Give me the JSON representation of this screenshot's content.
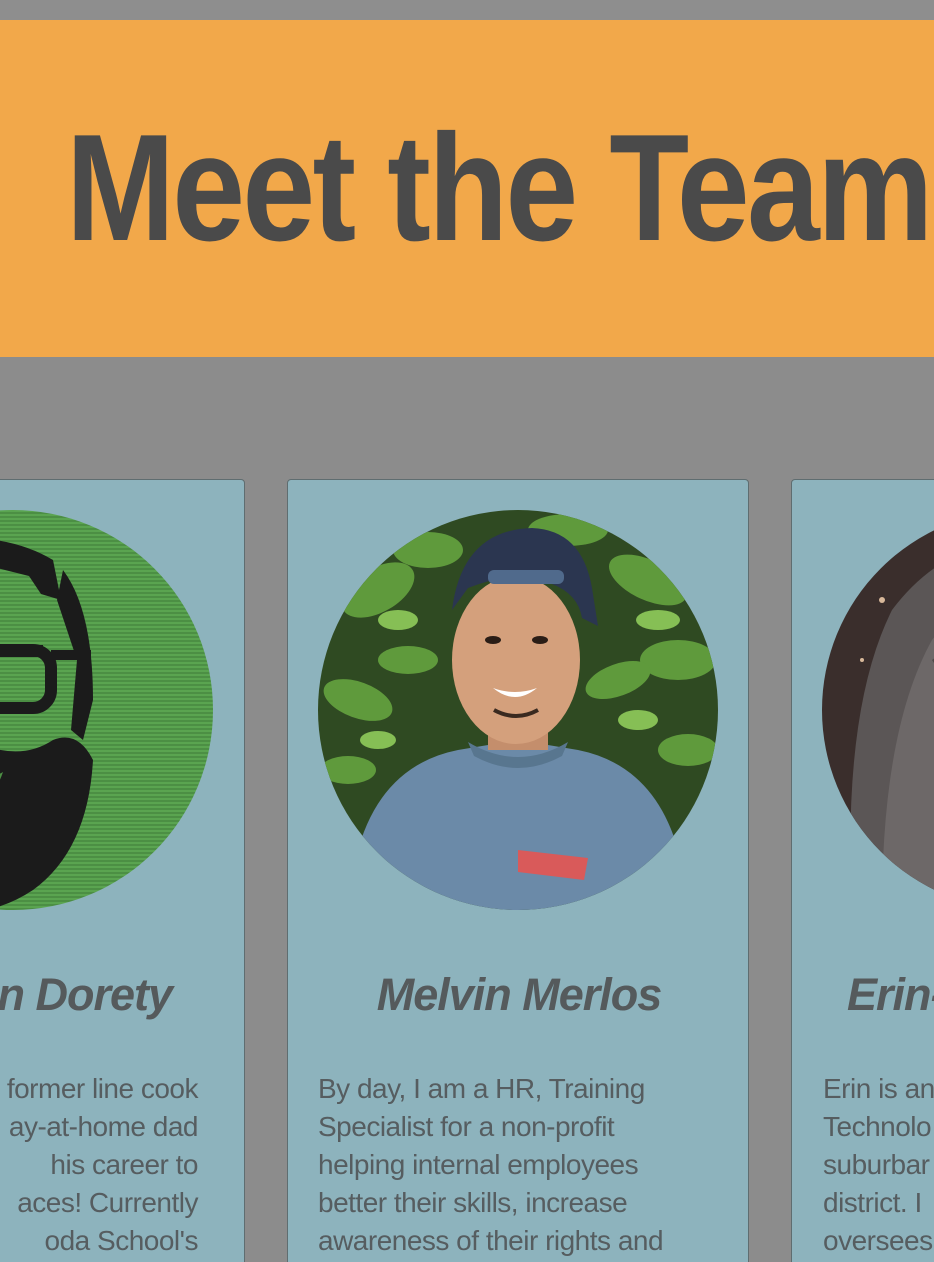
{
  "header": {
    "title": "Meet the Team"
  },
  "members": [
    {
      "name": "an Dorety",
      "photo": "pixelated-green-portrait-image",
      "bio_lines": [
        "former line cook",
        "ay-at-home dad",
        "his career to",
        "aces! Currently",
        "oda School's"
      ]
    },
    {
      "name": "Melvin Merlos",
      "photo": "portrait-photo-outdoors",
      "bio_lines": [
        "By day, I am a HR, Training",
        "Specialist for a non-profit",
        "helping internal employees",
        "better their skills, increase",
        "awareness of their rights and"
      ]
    },
    {
      "name": "Erin-",
      "photo": "portrait-photo-partial",
      "bio_lines": [
        "Erin is an",
        "Technolo",
        "suburbar",
        "district. I",
        "oversees"
      ]
    }
  ],
  "colors": {
    "background": "#8c8c8c",
    "banner": "#f2a84a",
    "title_text": "#4a4a4a",
    "card": "#8db3bd",
    "card_text": "#565d60"
  }
}
